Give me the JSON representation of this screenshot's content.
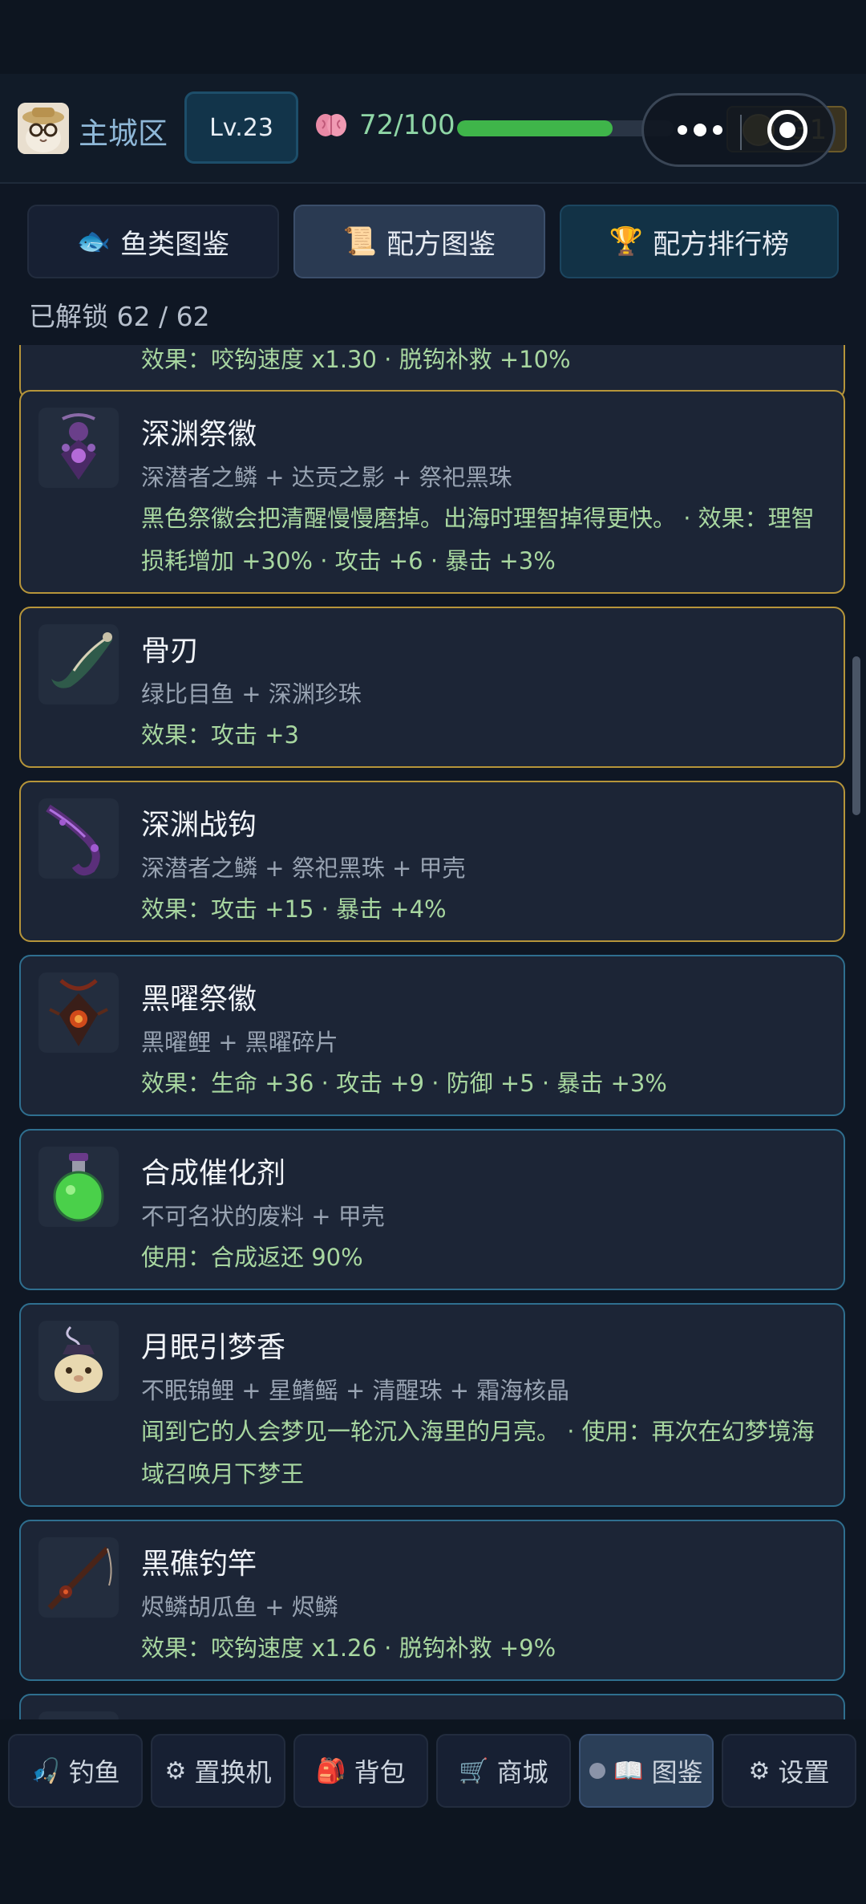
{
  "header": {
    "zone": "主城区",
    "level": "Lv.23",
    "sanity": "72/100",
    "sanity_fraction": 0.72,
    "coins": "31"
  },
  "tabs": [
    {
      "label": "鱼类图鉴",
      "icon": "fish-icon"
    },
    {
      "label": "配方图鉴",
      "icon": "scroll-icon"
    },
    {
      "label": "配方排行榜",
      "icon": "trophy-icon"
    }
  ],
  "unlock_text": "已解锁 62 / 62",
  "recipes": [
    {
      "title": "",
      "ingredients": "",
      "effect": "效果：咬钩速度 x1.30 · 脱钩补救 +10%"
    },
    {
      "title": "深渊祭徽",
      "ingredients": "深潜者之鳞 + 达贡之影 + 祭祀黑珠",
      "effect": "黑色祭徽会把清醒慢慢磨掉。出海时理智掉得更快。 · 效果：理智损耗增加 +30% · 攻击 +6 · 暴击 +3%"
    },
    {
      "title": "骨刃",
      "ingredients": "绿比目鱼 + 深渊珍珠",
      "effect": "效果：攻击 +3"
    },
    {
      "title": "深渊战钩",
      "ingredients": "深潜者之鳞 + 祭祀黑珠 + 甲壳",
      "effect": "效果：攻击 +15 · 暴击 +4%"
    },
    {
      "title": "黑曜祭徽",
      "ingredients": "黑曜鲤 + 黑曜碎片",
      "effect": "效果：生命 +36 · 攻击 +9 · 防御 +5 · 暴击 +3%"
    },
    {
      "title": "合成催化剂",
      "ingredients": "不可名状的废料 + 甲壳",
      "effect": "使用：合成返还 90%"
    },
    {
      "title": "月眠引梦香",
      "ingredients": "不眠锦鲤 + 星鳍鳐 + 清醒珠 + 霜海核晶",
      "effect": "闻到它的人会梦见一轮沉入海里的月亮。 · 使用：再次在幻梦境海域召唤月下梦王"
    },
    {
      "title": "黑礁钓竿",
      "ingredients": "烬鳞胡瓜鱼 + 烬鳞",
      "effect": "效果：咬钩速度 x1.26 · 脱钩补救 +9%"
    }
  ],
  "nav": [
    {
      "label": "钓鱼",
      "icon": "fishing-icon"
    },
    {
      "label": "置换机",
      "icon": "machine-icon"
    },
    {
      "label": "背包",
      "icon": "backpack-icon"
    },
    {
      "label": "商城",
      "icon": "cart-icon"
    },
    {
      "label": "图鉴",
      "icon": "book-icon"
    },
    {
      "label": "设置",
      "icon": "gear-icon"
    }
  ]
}
